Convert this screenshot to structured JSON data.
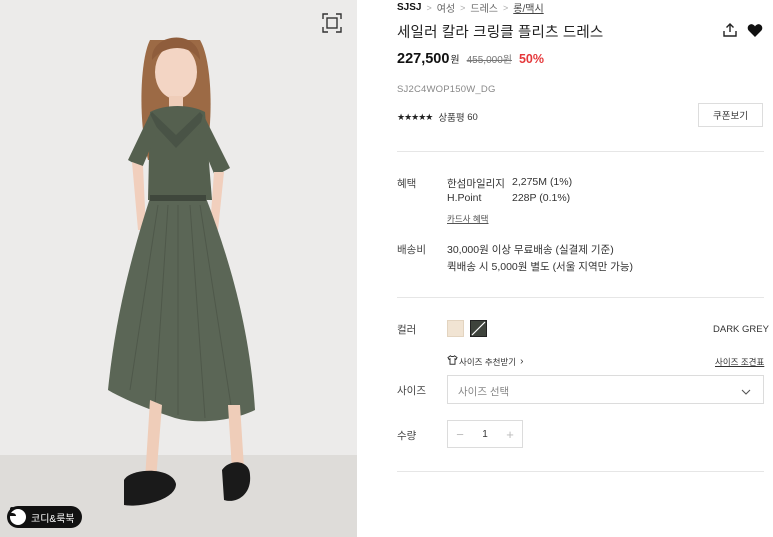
{
  "image": {
    "zoom_icon": "fullscreen-frame-icon",
    "coordi_button_label": "코디&룩북",
    "coordi_icon": "person-icon"
  },
  "breadcrumb": {
    "brand": "SJSJ",
    "items": [
      "여성",
      "드레스",
      "롱/맥시"
    ],
    "separator_icon": "chevron-right-icon"
  },
  "product": {
    "title": "세일러 칼라 크링클 플리츠 드레스",
    "price": "227,500",
    "price_unit": "원",
    "original_price": "455,000원",
    "discount": "50%",
    "sku": "SJ2C4WOP150W_DG",
    "rating_stars": "★★★★★",
    "rating": 4.5,
    "review_label": "상품평",
    "review_count": "60",
    "coupon_label": "쿠폰보기",
    "share_icon": "share-icon",
    "wishlist_icon": "heart-icon"
  },
  "benefits": {
    "label": "혜택",
    "rows": [
      {
        "name": "한섬마일리지",
        "value": "2,275M (1%)"
      },
      {
        "name": "H.Point",
        "value": "228P (0.1%)"
      }
    ],
    "card_link": "카드사 혜택"
  },
  "shipping": {
    "label": "배송비",
    "lines": [
      "30,000원 이상 무료배송 (실결제 기준)",
      "퀵배송 시 5,000원 별도 (서울 지역만 가능)"
    ]
  },
  "color": {
    "label": "컬러",
    "selected": "DARK GREY",
    "swatches": [
      "#f1e4d3",
      "#3e433c"
    ]
  },
  "size": {
    "recommend_label": "사이즈 추천받기",
    "recommend_icon": "tshirt-icon",
    "chart_label": "사이즈 조견표",
    "label": "사이즈",
    "placeholder": "사이즈 선택",
    "arrow_icon": "chevron-down-icon"
  },
  "quantity": {
    "label": "수량",
    "value": "1",
    "minus": "−",
    "plus": "+"
  }
}
